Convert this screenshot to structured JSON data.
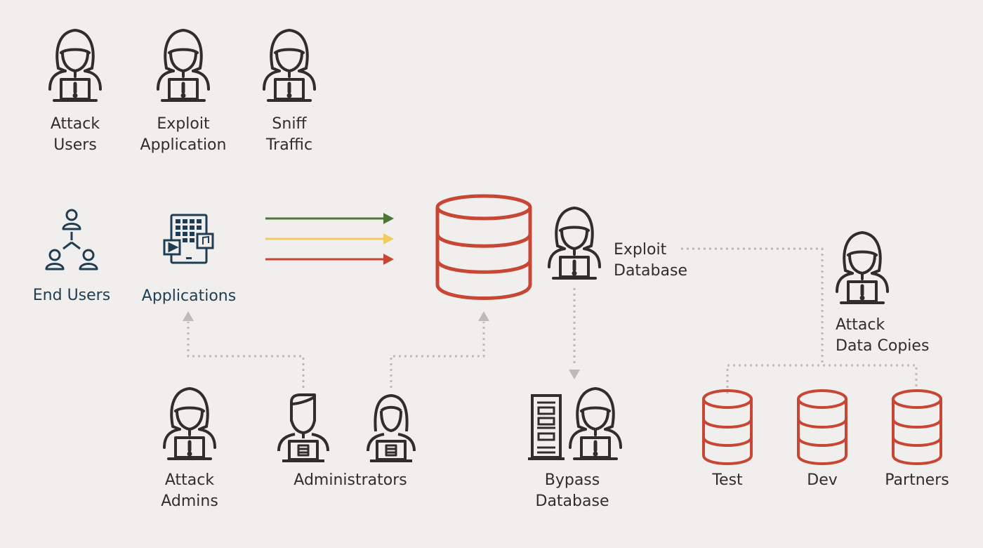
{
  "colors": {
    "background": "#f1efed",
    "icon_dark": "#312d2a",
    "icon_blue": "#1e3d52",
    "database_red": "#c74634",
    "arrow_green": "#4d7538",
    "arrow_yellow": "#f0cc5e",
    "arrow_red": "#c74634",
    "connector_gray": "#bdbab7"
  },
  "threats": {
    "attack_users": "Attack\nUsers",
    "exploit_application": "Exploit\nApplication",
    "sniff_traffic": "Sniff\nTraffic",
    "exploit_database": "Exploit\nDatabase",
    "attack_data_copies": "Attack\nData Copies",
    "attack_admins": "Attack\nAdmins",
    "bypass_database": "Bypass\nDatabase"
  },
  "entities": {
    "end_users": "End Users",
    "applications": "Applications",
    "administrators": "Administrators"
  },
  "data_copies": [
    "Test",
    "Dev",
    "Partners"
  ]
}
